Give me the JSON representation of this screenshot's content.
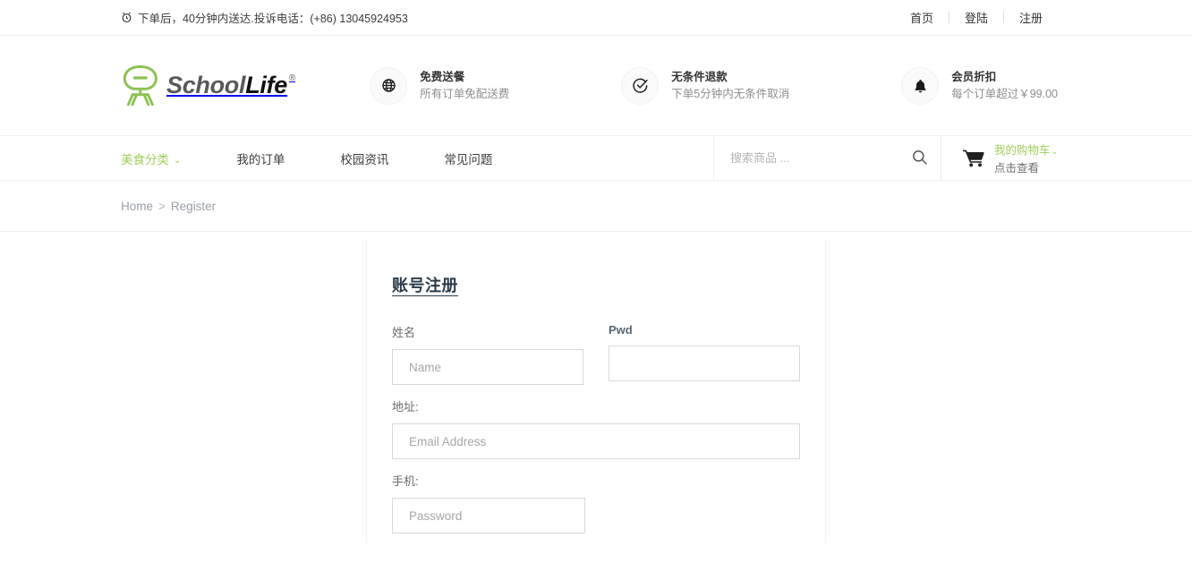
{
  "topbar": {
    "clock_icon": "alarm-clock-icon",
    "notice": "下单后，40分钟内送达.投诉电话：(+86) 13045924953",
    "links": [
      {
        "label": "首页"
      },
      {
        "label": "登陆"
      },
      {
        "label": "注册"
      }
    ]
  },
  "header": {
    "logo": {
      "mark_icon": "chair-logo-icon",
      "school": "School",
      "life": "Life",
      "registered": "®"
    },
    "features": [
      {
        "icon": "globe-icon",
        "title": "免费送餐",
        "subtitle": "所有订单免配送费"
      },
      {
        "icon": "check-circle-icon",
        "title": "无条件退款",
        "subtitle": "下单5分钟内无条件取消"
      },
      {
        "icon": "bell-icon",
        "title": "会员折扣",
        "subtitle": "每个订单超过￥99.00"
      }
    ]
  },
  "nav": {
    "items": [
      {
        "label": "美食分类",
        "active": true,
        "caret": "⌄"
      },
      {
        "label": "我的订单",
        "active": false
      },
      {
        "label": "校园资讯",
        "active": false
      },
      {
        "label": "常见问题",
        "active": false
      }
    ],
    "search": {
      "placeholder": "搜索商品 ...",
      "value": "",
      "icon": "search-icon"
    },
    "cart": {
      "icon": "shopping-cart-icon",
      "title": "我的购物车",
      "caret": "⌄",
      "subtitle": "点击查看"
    }
  },
  "breadcrumb": {
    "home": "Home",
    "separator": ">",
    "current": "Register"
  },
  "form": {
    "title": "账号注册",
    "fields": {
      "name": {
        "label": "姓名",
        "placeholder": "Name",
        "value": ""
      },
      "pwd": {
        "label": "Pwd",
        "placeholder": "",
        "value": ""
      },
      "address": {
        "label": "地址:",
        "placeholder": "Email Address",
        "value": ""
      },
      "phone": {
        "label": "手机:",
        "placeholder": "Password",
        "value": ""
      }
    }
  },
  "colors": {
    "brand_green": "#a2cd5a",
    "text_dark": "#333333",
    "text_muted": "#8d8d8d",
    "border": "#eeeeee"
  }
}
